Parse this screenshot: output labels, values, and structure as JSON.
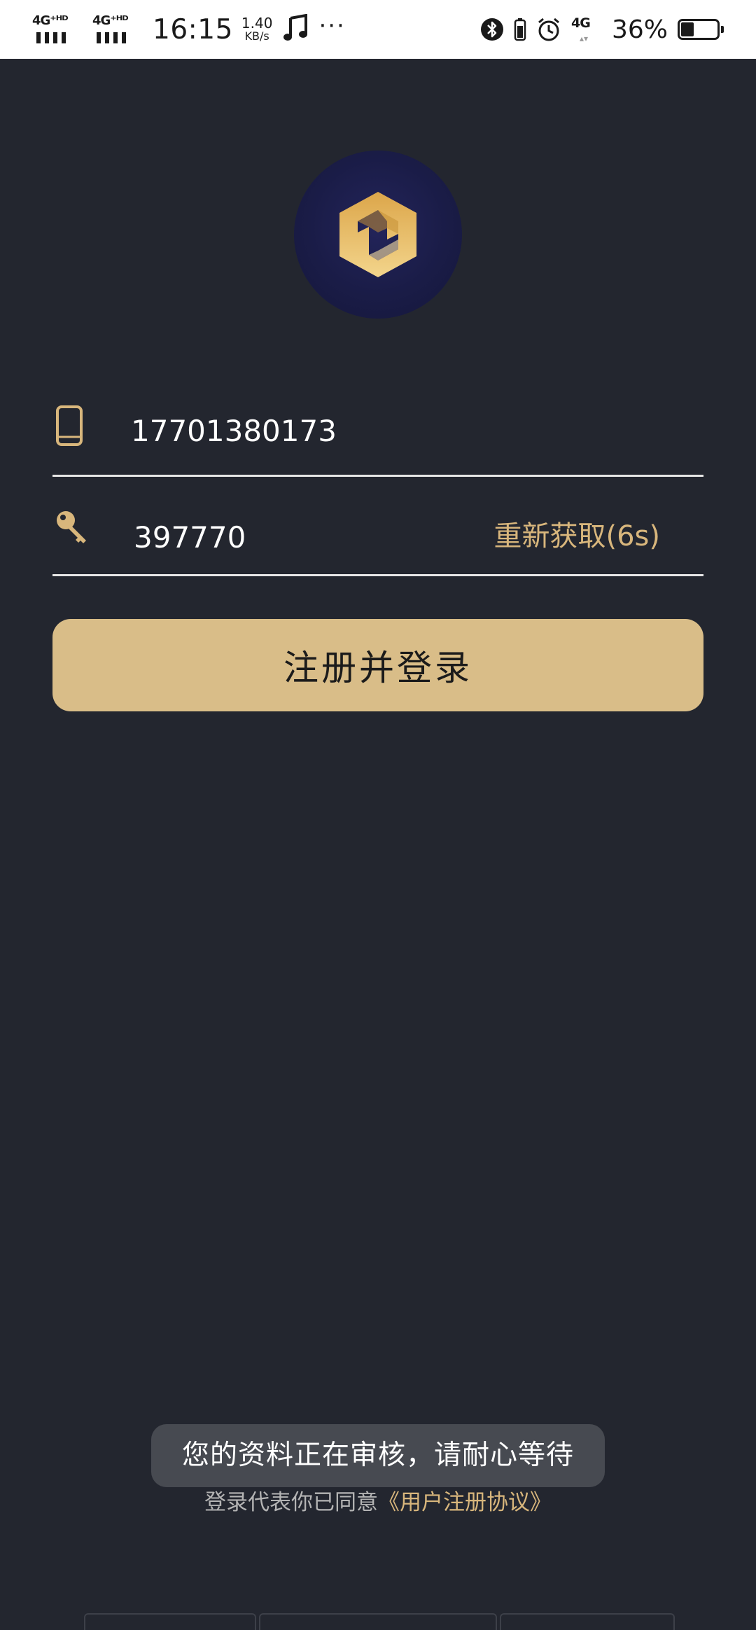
{
  "status_bar": {
    "signal1": "4G⁺ᴴᴰ",
    "signal2": "4G⁺ᴴᴰ",
    "time": "16:15",
    "speed_value": "1.40",
    "speed_unit": "KB/s",
    "more": "···",
    "network": "4G",
    "battery_percent": "36%",
    "battery_level": 0.36
  },
  "logo": {
    "icon": "app-logo-icon",
    "accent": "#e2b456"
  },
  "form": {
    "phone": {
      "icon": "phone-icon",
      "value": "17701380173"
    },
    "code": {
      "icon": "key-icon",
      "value": "397770",
      "resend_label": "重新获取(6s)"
    },
    "submit_label": "注册并登录"
  },
  "toast": {
    "text": "您的资料正在审核，请耐心等待"
  },
  "agreement": {
    "prefix": "登录代表你已同意",
    "link": "《用户注册协议》"
  },
  "colors": {
    "background": "#23262f",
    "accent": "#d8b67c",
    "button": "#d9bd88",
    "toast": "#474a51"
  }
}
